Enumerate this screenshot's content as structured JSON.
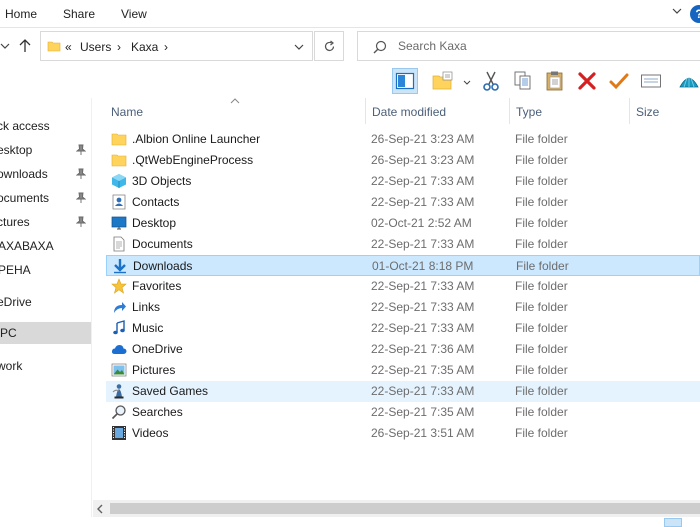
{
  "ribbon": {
    "tabs": [
      "Home",
      "Share",
      "View"
    ],
    "help_label": "?"
  },
  "address": {
    "overflow": "«",
    "segments": [
      "Users",
      "Kaxa"
    ],
    "separator": "›"
  },
  "search": {
    "placeholder": "Search Kaxa"
  },
  "toolbar": {
    "buttons": [
      "preview-pane",
      "properties",
      "cut",
      "copy",
      "paste",
      "delete",
      "rename",
      "email",
      "shell"
    ]
  },
  "nav_pane": {
    "items": [
      {
        "label": "ck access",
        "pinned": false
      },
      {
        "label": "esktop",
        "pinned": true
      },
      {
        "label": "ownloads",
        "pinned": true
      },
      {
        "label": "ocuments",
        "pinned": true
      },
      {
        "label": "ctures",
        "pinned": true
      },
      {
        "label": "АХАВАХА",
        "pinned": false
      },
      {
        "label": "РЕНА",
        "pinned": false
      },
      {
        "label": "eDrive",
        "pinned": false
      },
      {
        "label": " PC",
        "pinned": false,
        "selected": true
      },
      {
        "label": "work",
        "pinned": false
      }
    ]
  },
  "columns": {
    "name": "Name",
    "date": "Date modified",
    "type": "Type",
    "size": "Size"
  },
  "files": [
    {
      "name": ".Albion Online Launcher",
      "date": "26-Sep-21 3:23 AM",
      "type": "File folder",
      "icon": "folder-icon"
    },
    {
      "name": ".QtWebEngineProcess",
      "date": "26-Sep-21 3:23 AM",
      "type": "File folder",
      "icon": "folder-icon"
    },
    {
      "name": "3D Objects",
      "date": "22-Sep-21 7:33 AM",
      "type": "File folder",
      "icon": "cube-icon"
    },
    {
      "name": "Contacts",
      "date": "22-Sep-21 7:33 AM",
      "type": "File folder",
      "icon": "contacts-icon"
    },
    {
      "name": "Desktop",
      "date": "02-Oct-21 2:52 AM",
      "type": "File folder",
      "icon": "desktop-icon"
    },
    {
      "name": "Documents",
      "date": "22-Sep-21 7:33 AM",
      "type": "File folder",
      "icon": "document-icon"
    },
    {
      "name": "Downloads",
      "date": "01-Oct-21 8:18 PM",
      "type": "File folder",
      "icon": "download-icon"
    },
    {
      "name": "Favorites",
      "date": "22-Sep-21 7:33 AM",
      "type": "File folder",
      "icon": "star-icon"
    },
    {
      "name": "Links",
      "date": "22-Sep-21 7:33 AM",
      "type": "File folder",
      "icon": "link-arrow-icon"
    },
    {
      "name": "Music",
      "date": "22-Sep-21 7:33 AM",
      "type": "File folder",
      "icon": "music-note-icon"
    },
    {
      "name": "OneDrive",
      "date": "22-Sep-21 7:36 AM",
      "type": "File folder",
      "icon": "cloud-icon"
    },
    {
      "name": "Pictures",
      "date": "22-Sep-21 7:35 AM",
      "type": "File folder",
      "icon": "picture-icon"
    },
    {
      "name": "Saved Games",
      "date": "22-Sep-21 7:33 AM",
      "type": "File folder",
      "icon": "chess-piece-icon"
    },
    {
      "name": "Searches",
      "date": "22-Sep-21 7:35 AM",
      "type": "File folder",
      "icon": "search-icon"
    },
    {
      "name": "Videos",
      "date": "26-Sep-21 3:51 AM",
      "type": "File folder",
      "icon": "film-icon"
    }
  ],
  "selected_row": "Downloads",
  "hover_row": "Saved Games",
  "colors": {
    "selection_bg": "#cce8ff",
    "hover_bg": "#e5f3ff",
    "header_text": "#4c607a",
    "folder_yellow": "#ffd35c"
  }
}
